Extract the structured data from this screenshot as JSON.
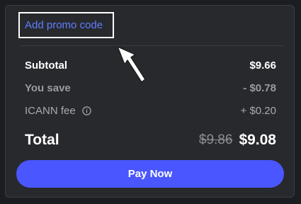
{
  "promo": {
    "link_label": "Add promo code"
  },
  "summary": {
    "subtotal_label": "Subtotal",
    "subtotal_value": "$9.66",
    "save_label": "You save",
    "save_value": "- $0.78",
    "fee_label": "ICANN fee",
    "fee_value": "+ $0.20",
    "total_label": "Total",
    "total_old_price": "$9.86",
    "total_new_price": "$9.08"
  },
  "actions": {
    "pay_label": "Pay Now"
  },
  "colors": {
    "background": "#1c1d20",
    "card": "#28292d",
    "accent": "#4a56ff",
    "link": "#5f7fff"
  },
  "icons": {
    "fee_info": "info-icon",
    "annotation": "arrow-pointer-icon"
  }
}
